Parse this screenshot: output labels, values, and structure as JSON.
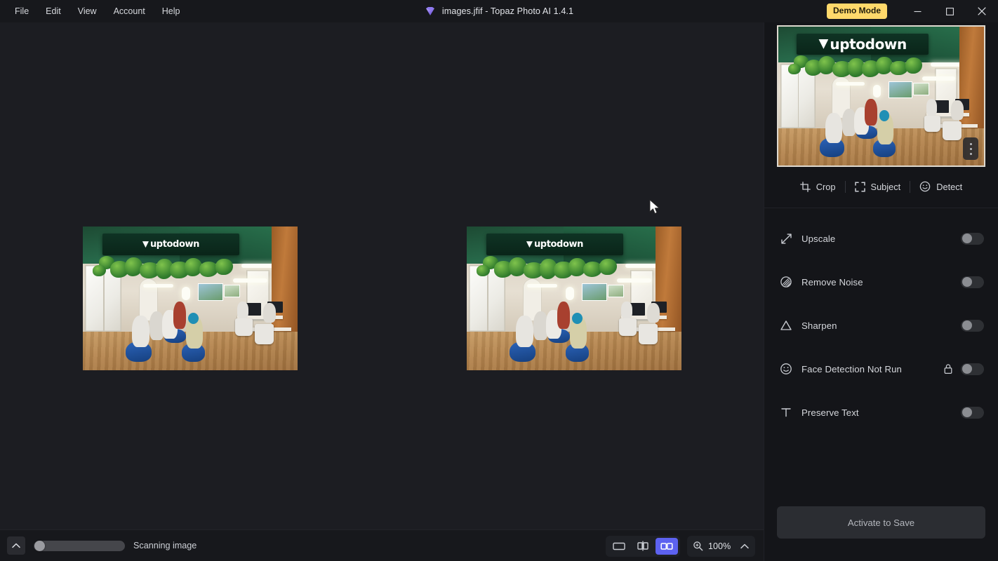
{
  "window": {
    "title": "images.jfif - Topaz Photo AI 1.4.1",
    "app_icon": "gem-icon",
    "demo_badge": "Demo Mode",
    "minimize": "minimize-icon",
    "maximize": "maximize-icon",
    "close": "close-icon"
  },
  "menu": {
    "items": [
      {
        "label": "File"
      },
      {
        "label": "Edit"
      },
      {
        "label": "View"
      },
      {
        "label": "Account"
      },
      {
        "label": "Help"
      }
    ]
  },
  "canvas": {
    "view_mode": "side-by-side",
    "images": [
      {
        "name": "original-preview",
        "alt": "uptodown office interior",
        "logo_text": "uptodown"
      },
      {
        "name": "processed-preview",
        "alt": "uptodown office interior",
        "logo_text": "uptodown"
      }
    ]
  },
  "statusbar": {
    "collapse_icon": "chevron-up-icon",
    "progress_percent": 8,
    "status_text": "Scanning image",
    "view_modes": [
      {
        "name": "single-view",
        "icon": "single-pane-icon",
        "active": false
      },
      {
        "name": "split-view",
        "icon": "split-pane-icon",
        "active": false
      },
      {
        "name": "side-by-side-view",
        "icon": "dual-pane-icon",
        "active": true
      }
    ],
    "zoom": {
      "icon": "magnifier-icon",
      "value": "100%",
      "caret": "chevron-up-icon"
    }
  },
  "right_panel": {
    "thumbnail": {
      "name": "image-thumbnail",
      "logo_text": "uptodown",
      "menu_icon": "more-vertical-icon"
    },
    "tools": [
      {
        "label": "Crop",
        "icon": "crop-icon"
      },
      {
        "label": "Subject",
        "icon": "subject-brackets-icon"
      },
      {
        "label": "Detect",
        "icon": "face-detect-icon"
      }
    ],
    "filters": [
      {
        "label": "Upscale",
        "icon": "upscale-arrows-icon",
        "enabled": false,
        "locked": false
      },
      {
        "label": "Remove Noise",
        "icon": "remove-noise-icon",
        "enabled": false,
        "locked": false
      },
      {
        "label": "Sharpen",
        "icon": "sharpen-triangle-icon",
        "enabled": false,
        "locked": false
      },
      {
        "label": "Face Detection Not Run",
        "icon": "face-smiley-icon",
        "enabled": false,
        "locked": true
      },
      {
        "label": "Preserve Text",
        "icon": "text-t-icon",
        "enabled": false,
        "locked": false
      }
    ],
    "save_button": "Activate to Save"
  },
  "colors": {
    "titlebar_bg": "#17181c",
    "canvas_bg": "#1c1d22",
    "panel_bg": "#141519",
    "accent": "#5d62f0",
    "demo_badge_bg": "#ffd96b",
    "toggle_off_track": "#2e3034",
    "toggle_off_knob": "#8b8d92"
  }
}
